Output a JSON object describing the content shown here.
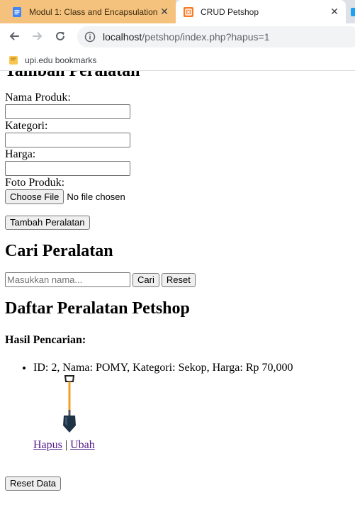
{
  "browser": {
    "tabs": [
      {
        "title": "Modul 1: Class and Encapsulation",
        "icon": "docs-icon",
        "active": false
      },
      {
        "title": "CRUD Petshop",
        "icon": "xampp-icon",
        "active": true
      }
    ],
    "close_glyph": "✕",
    "url_host": "localhost",
    "url_path": "/petshop/index.php?hapus=1",
    "bookmark": "upi.edu bookmarks",
    "colors": {
      "inactive_tab": "#f5c27d",
      "xampp": "#fb7a24",
      "docs": "#4285f4"
    }
  },
  "form": {
    "heading": "Tambah Peralatan",
    "nama_label": "Nama Produk:",
    "nama_value": "",
    "kategori_label": "Kategori:",
    "kategori_value": "",
    "harga_label": "Harga:",
    "harga_value": "",
    "foto_label": "Foto Produk:",
    "choose_file": "Choose File",
    "no_file": "No file chosen",
    "submit": "Tambah Peralatan"
  },
  "search": {
    "heading": "Cari Peralatan",
    "placeholder": "Masukkan nama...",
    "value": "",
    "cari": "Cari",
    "reset": "Reset"
  },
  "list": {
    "heading": "Daftar Peralatan Petshop",
    "subheading": "Hasil Pencarian:",
    "items": [
      {
        "text": "ID: 2, Nama: POMY, Kategori: Sekop, Harga: Rp 70,000",
        "image": "shovel-image",
        "hapus": "Hapus",
        "separator": "|",
        "ubah": "Ubah"
      }
    ],
    "reset_data": "Reset Data"
  }
}
